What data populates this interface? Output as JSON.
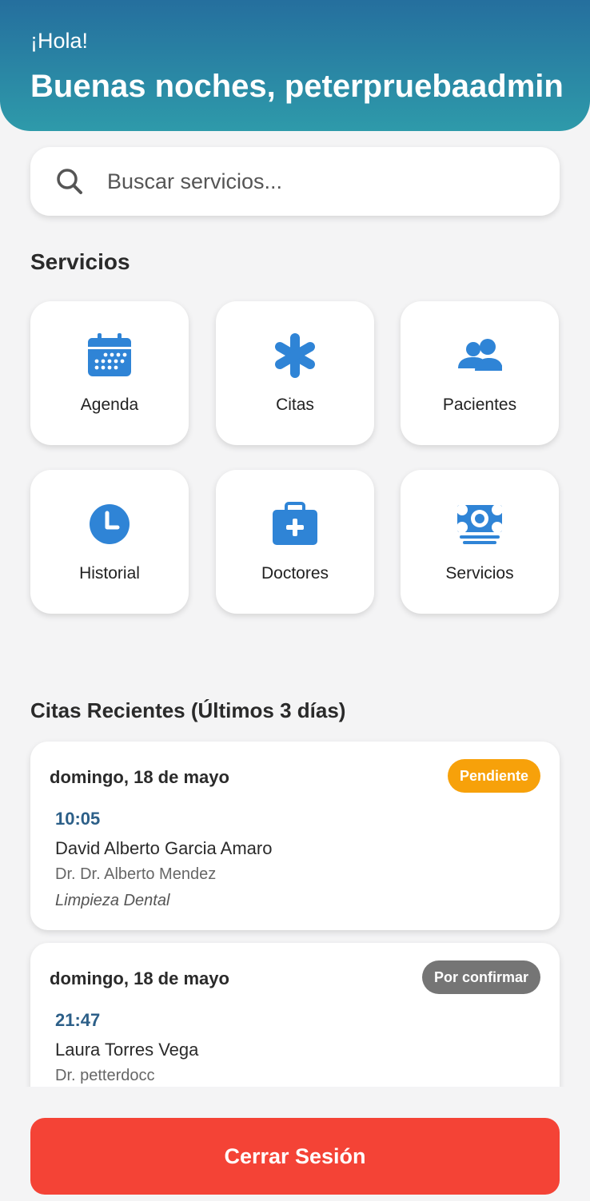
{
  "header": {
    "greeting": "¡Hola!",
    "welcome": "Buenas noches, peterpruebaadmin"
  },
  "search": {
    "placeholder": "Buscar servicios...",
    "icon": "search-icon"
  },
  "services": {
    "title": "Servicios",
    "items": [
      {
        "label": "Agenda",
        "icon": "calendar-icon"
      },
      {
        "label": "Citas",
        "icon": "asterisk-icon"
      },
      {
        "label": "Pacientes",
        "icon": "users-icon"
      },
      {
        "label": "Historial",
        "icon": "clock-icon"
      },
      {
        "label": "Doctores",
        "icon": "medkit-icon"
      },
      {
        "label": "Servicios",
        "icon": "money-icon"
      }
    ]
  },
  "recent": {
    "title": "Citas Recientes (Últimos 3 días)",
    "appointments": [
      {
        "date": "domingo, 18 de mayo",
        "status": "Pendiente",
        "time": "10:05",
        "patient": "David Alberto Garcia Amaro",
        "doctor": "Dr. Dr. Alberto Mendez",
        "service": "Limpieza Dental"
      },
      {
        "date": "domingo, 18 de mayo",
        "status": "Por confirmar",
        "time": "21:47",
        "patient": "Laura Torres Vega",
        "doctor": "Dr. petterdocc"
      }
    ]
  },
  "logout_label": "Cerrar Sesión",
  "colors": {
    "accent": "#2f84d6",
    "header_start": "#256f9e",
    "header_end": "#2e9aaa",
    "pending": "#f7a10a",
    "unconfirmed": "#757575",
    "logout": "#f44336",
    "time": "#2c5f88"
  }
}
